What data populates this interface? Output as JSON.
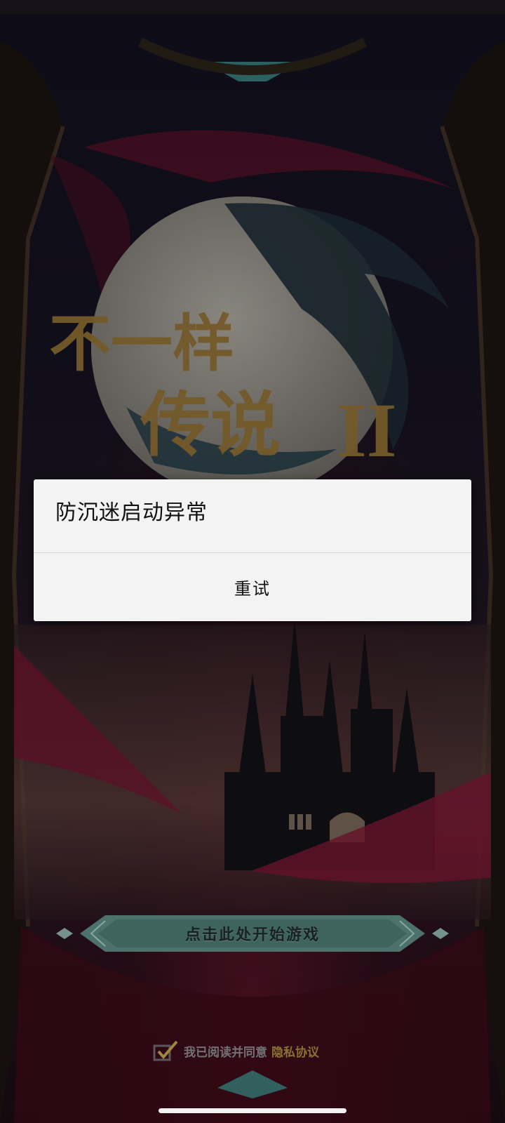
{
  "dialog": {
    "title": "防沉迷启动异常",
    "retry_label": "重试"
  },
  "game": {
    "logo_text": "不一样传说II",
    "start_label": "点击此处开始游戏",
    "agreement_text": "我已阅读并同意",
    "privacy_link": "隐私协议"
  },
  "colors": {
    "dialog_bg": "#f3f3f3",
    "privacy_link": "#a88a3c",
    "banner": "#5f8a86"
  }
}
